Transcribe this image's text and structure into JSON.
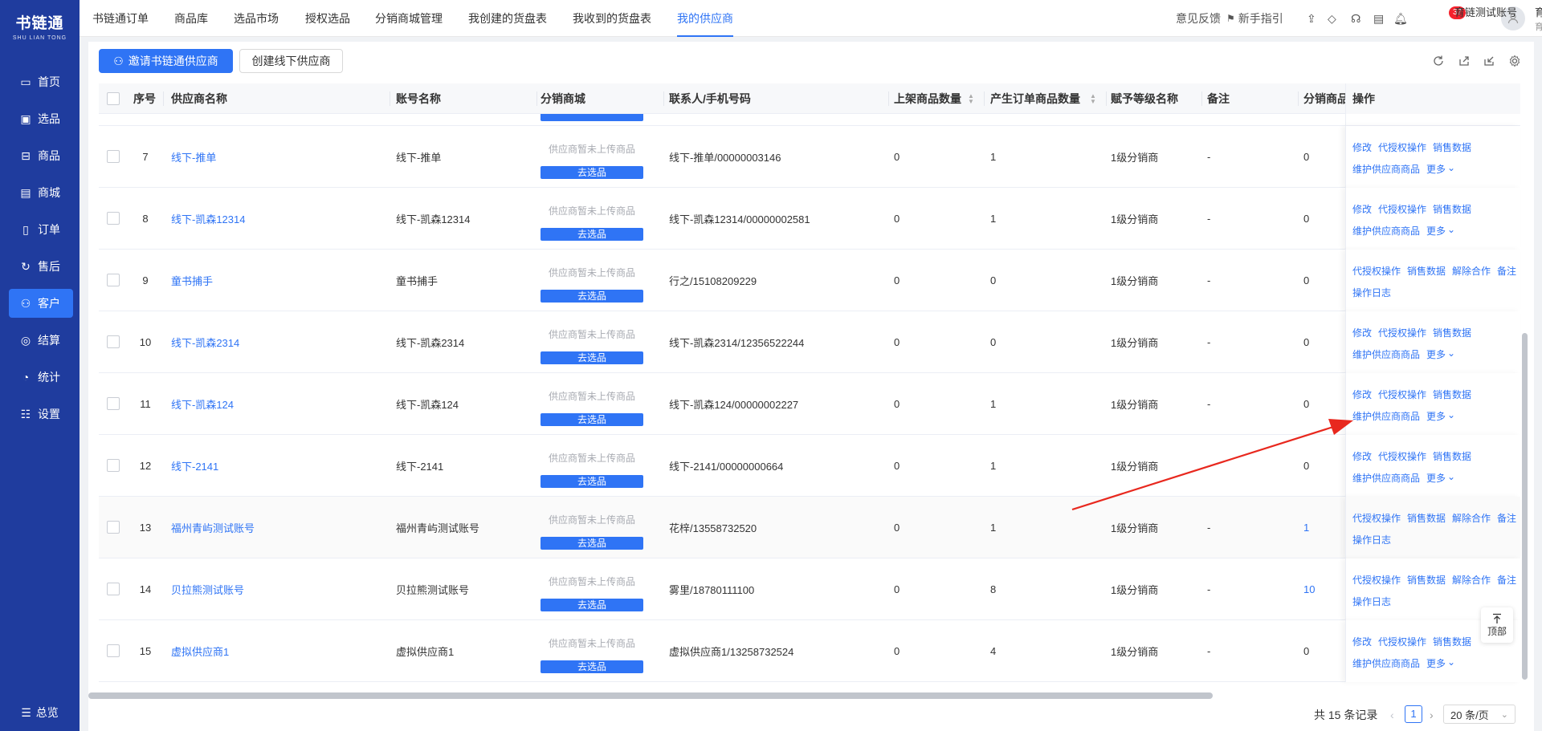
{
  "sidebar": {
    "logo_main": "书链通",
    "logo_sub": "SHU LIAN TONG",
    "items": [
      {
        "label": "首页",
        "icon": "monitor-icon"
      },
      {
        "label": "选品",
        "icon": "select-icon"
      },
      {
        "label": "商品",
        "icon": "goods-icon"
      },
      {
        "label": "商城",
        "icon": "mall-icon"
      },
      {
        "label": "订单",
        "icon": "order-icon"
      },
      {
        "label": "售后",
        "icon": "aftersale-icon"
      },
      {
        "label": "客户",
        "icon": "customer-icon",
        "active": true
      },
      {
        "label": "结算",
        "icon": "settle-icon"
      },
      {
        "label": "统计",
        "icon": "chart-icon"
      },
      {
        "label": "设置",
        "icon": "settings-icon"
      }
    ],
    "bottom_label": "总览"
  },
  "topnav": {
    "tabs": [
      "书链通订单",
      "商品库",
      "选品市场",
      "授权选品",
      "分销商城管理",
      "我创建的货盘表",
      "我收到的货盘表",
      "我的供应商"
    ],
    "active_tab": "我的供应商",
    "feedback": "意见反馈",
    "guide": "新手指引",
    "notice_count": "37",
    "user_name": "育链测试账号",
    "user_sub": "育链测试账号"
  },
  "toolbar": {
    "invite_label": "邀请书链通供应商",
    "create_label": "创建线下供应商"
  },
  "table": {
    "headers": {
      "index": "序号",
      "name": "供应商名称",
      "account": "账号名称",
      "mall": "分销商城",
      "contact": "联系人/手机号码",
      "listed": "上架商品数量",
      "ordered": "产生订单商品数量",
      "level": "赋予等级名称",
      "remark": "备注",
      "mall_goods": "分销商品",
      "ops": "操作"
    },
    "mall_tip": "供应商暂未上传商品",
    "mall_button": "去选品",
    "rows": [
      {
        "index": "7",
        "name": "线下-推单",
        "account": "线下-推单",
        "contact": "线下-推单/00000003146",
        "listed": "0",
        "ordered": "1",
        "level": "1级分销商",
        "remark": "-",
        "mall_goods": "0",
        "ops_type": "A"
      },
      {
        "index": "8",
        "name": "线下-凯森12314",
        "account": "线下-凯森12314",
        "contact": "线下-凯森12314/00000002581",
        "listed": "0",
        "ordered": "1",
        "level": "1级分销商",
        "remark": "-",
        "mall_goods": "0",
        "ops_type": "A"
      },
      {
        "index": "9",
        "name": "童书捕手",
        "account": "童书捕手",
        "contact": "行之/15108209229",
        "listed": "0",
        "ordered": "0",
        "level": "1级分销商",
        "remark": "-",
        "mall_goods": "0",
        "ops_type": "B"
      },
      {
        "index": "10",
        "name": "线下-凯森2314",
        "account": "线下-凯森2314",
        "contact": "线下-凯森2314/12356522244",
        "listed": "0",
        "ordered": "0",
        "level": "1级分销商",
        "remark": "-",
        "mall_goods": "0",
        "ops_type": "A"
      },
      {
        "index": "11",
        "name": "线下-凯森124",
        "account": "线下-凯森124",
        "contact": "线下-凯森124/00000002227",
        "listed": "0",
        "ordered": "1",
        "level": "1级分销商",
        "remark": "-",
        "mall_goods": "0",
        "ops_type": "A"
      },
      {
        "index": "12",
        "name": "线下-2141",
        "account": "线下-2141",
        "contact": "线下-2141/00000000664",
        "listed": "0",
        "ordered": "1",
        "level": "1级分销商",
        "remark": "-",
        "mall_goods": "0",
        "ops_type": "A"
      },
      {
        "index": "13",
        "name": "福州青屿测试账号",
        "account": "福州青屿测试账号",
        "contact": "花梓/13558732520",
        "listed": "0",
        "ordered": "1",
        "level": "1级分销商",
        "remark": "-",
        "mall_goods": "1",
        "ops_type": "B",
        "highlight": true
      },
      {
        "index": "14",
        "name": "贝拉熊测试账号",
        "account": "贝拉熊测试账号",
        "contact": "雾里/18780111100",
        "listed": "0",
        "ordered": "8",
        "level": "1级分销商",
        "remark": "-",
        "mall_goods": "10",
        "ops_type": "B"
      },
      {
        "index": "15",
        "name": "虚拟供应商1",
        "account": "虚拟供应商1",
        "contact": "虚拟供应商1/13258732524",
        "listed": "0",
        "ordered": "4",
        "level": "1级分销商",
        "remark": "-",
        "mall_goods": "0",
        "ops_type": "A"
      }
    ],
    "ops_a": {
      "line1": [
        "修改",
        "代授权操作",
        "销售数据"
      ],
      "line2": [
        "维护供应商商品",
        "更多"
      ]
    },
    "ops_b": {
      "line1": [
        "代授权操作",
        "销售数据",
        "解除合作",
        "备注"
      ],
      "line2": [
        "操作日志"
      ]
    }
  },
  "pagination": {
    "total_text": "共 15 条记录",
    "current_page": "1",
    "page_size": "20 条/页"
  },
  "back_to_top": "顶部",
  "colors": {
    "sidebar": "#1f3c9e",
    "accent": "#2f74f5",
    "annotation_arrow": "#e8281e"
  }
}
